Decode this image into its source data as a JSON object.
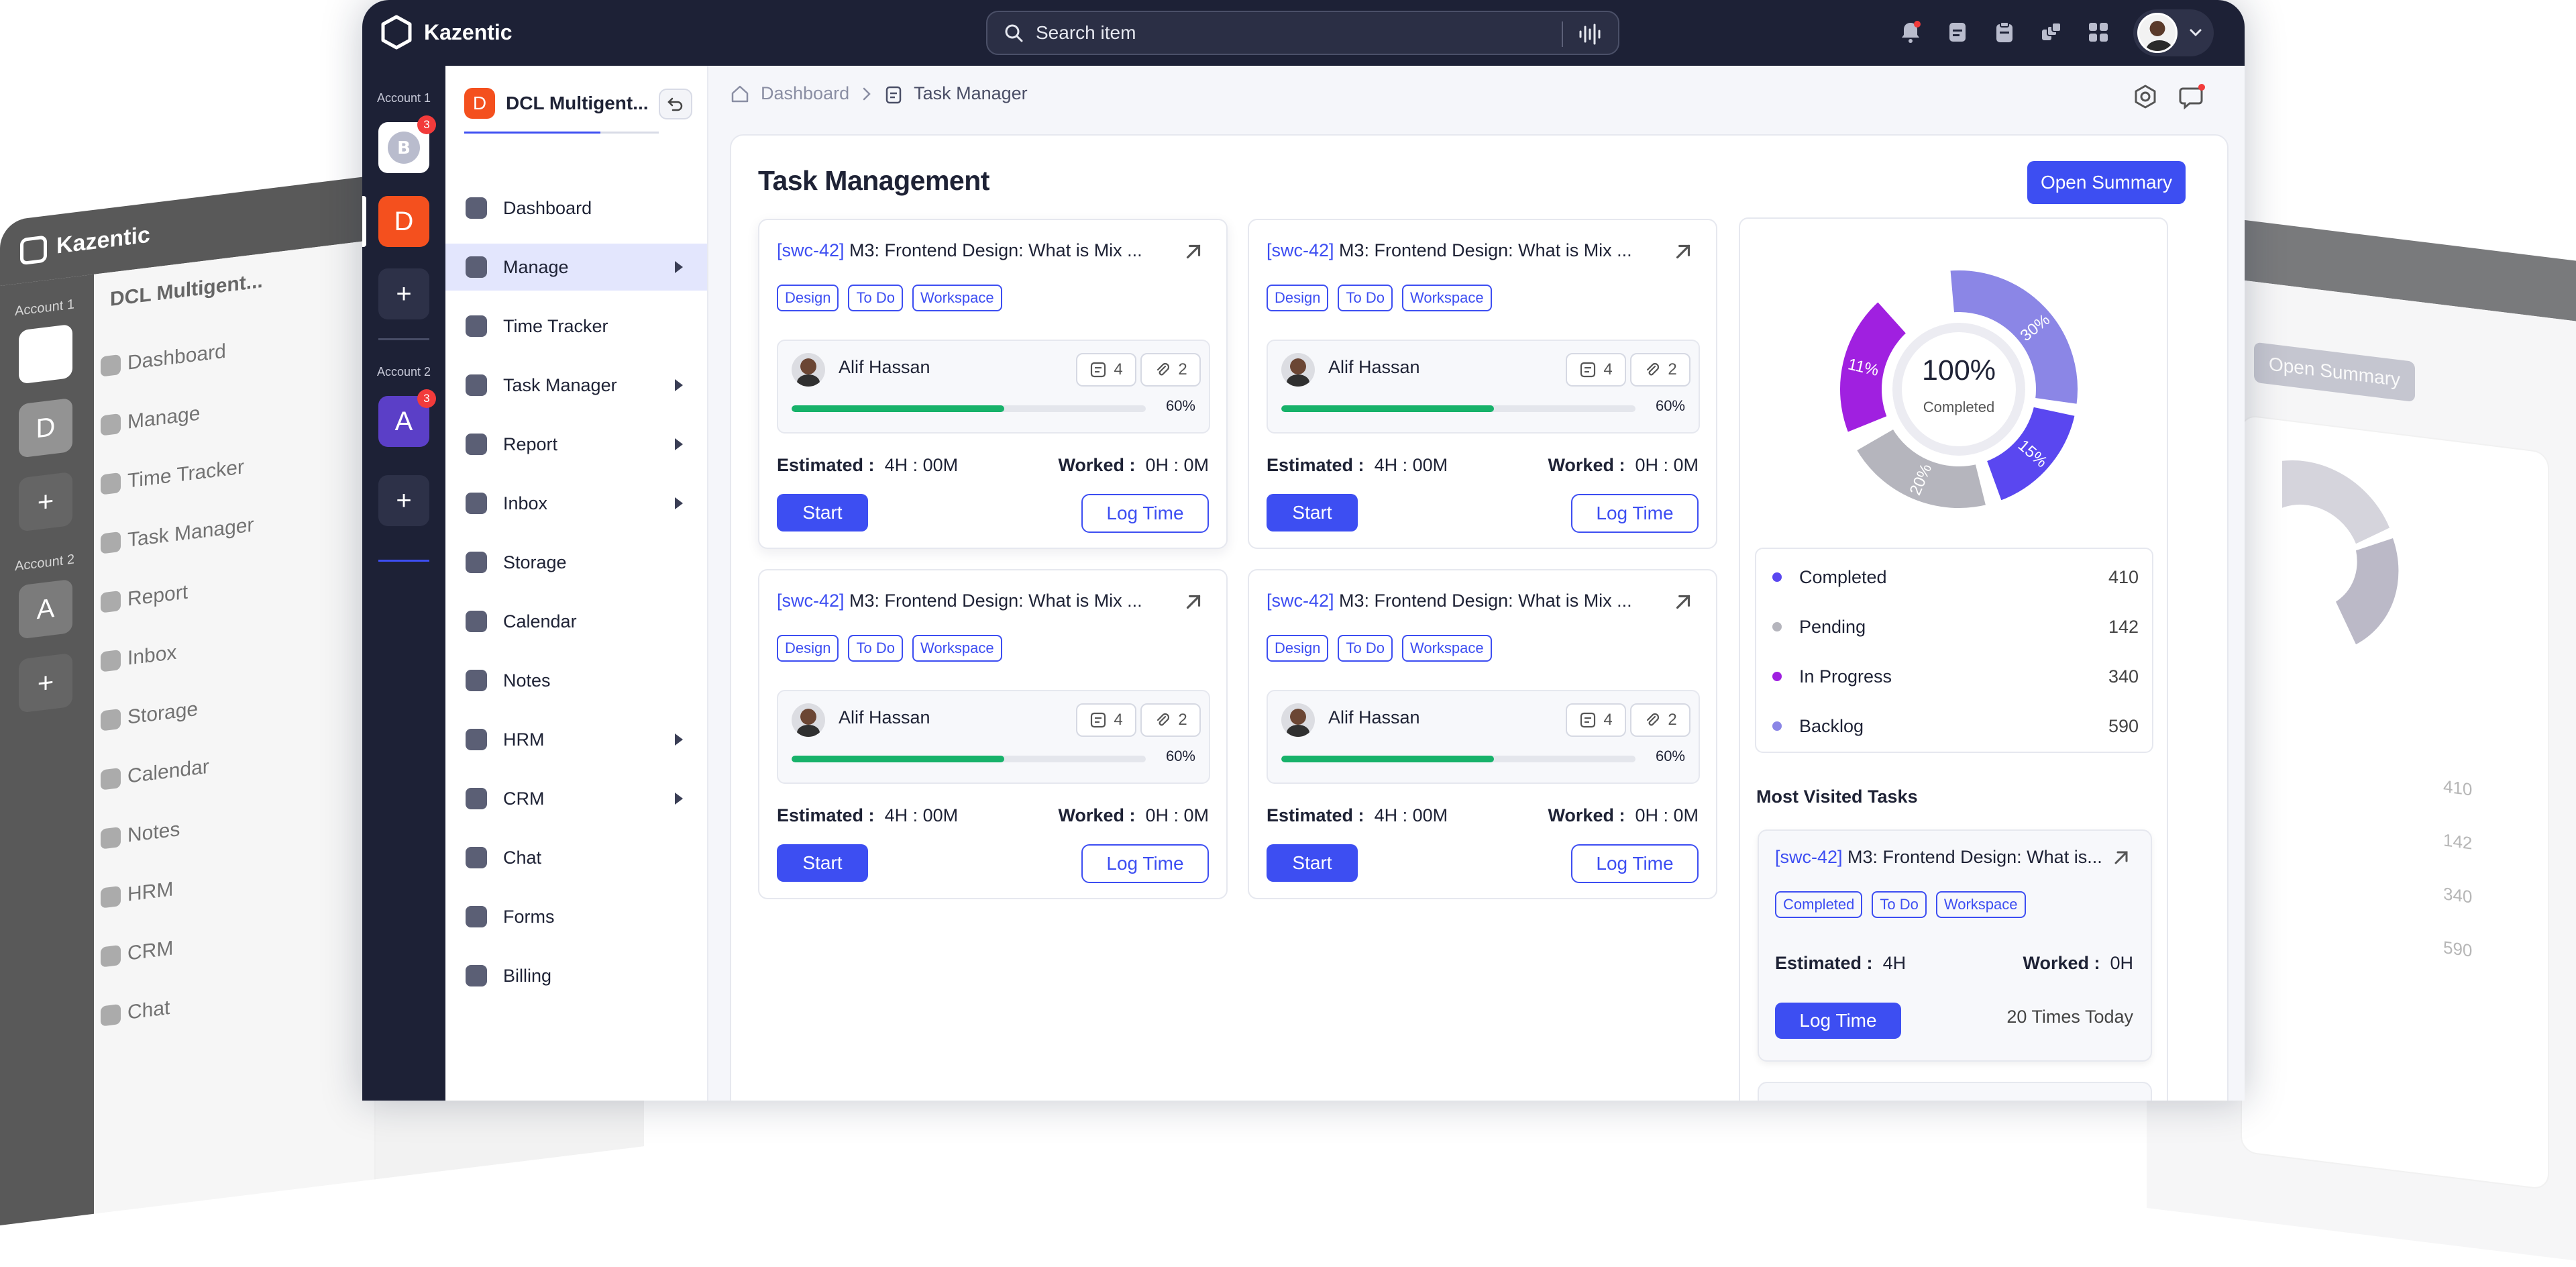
{
  "app": {
    "name": "Kazentic"
  },
  "search": {
    "placeholder": "Search item"
  },
  "rail": {
    "account1_label": "Account 1",
    "account1_badge": "3",
    "org_letter": "D",
    "plus": "+",
    "account2_label": "Account 2",
    "account2_letter": "A",
    "account2_badge": "3"
  },
  "nav": {
    "org_name": "DCL Multigent...",
    "items": [
      {
        "label": "Dashboard",
        "icon": "home-icon"
      },
      {
        "label": "Manage",
        "icon": "layers-icon"
      },
      {
        "label": "Time Tracker",
        "icon": "clock-icon"
      },
      {
        "label": "Task Manager",
        "icon": "clipboard-icon"
      },
      {
        "label": "Report",
        "icon": "chart-icon"
      },
      {
        "label": "Inbox",
        "icon": "inbox-icon"
      },
      {
        "label": "Storage",
        "icon": "cloud-icon"
      },
      {
        "label": "Calendar",
        "icon": "calendar-icon"
      },
      {
        "label": "Notes",
        "icon": "note-icon"
      },
      {
        "label": "HRM",
        "icon": "badge-icon"
      },
      {
        "label": "CRM",
        "icon": "crm-icon"
      },
      {
        "label": "Chat",
        "icon": "chat-icon"
      },
      {
        "label": "Forms",
        "icon": "form-icon"
      },
      {
        "label": "Billing",
        "icon": "billing-icon"
      }
    ]
  },
  "breadcrumb": {
    "home": "Dashboard",
    "current": "Task Manager"
  },
  "page": {
    "title": "Task Management",
    "summary_button": "Open Summary"
  },
  "task": {
    "key": "[swc-42]",
    "title": "M3: Frontend Design: What is Mix ...",
    "tags": [
      "Design",
      "To Do",
      "Workspace"
    ],
    "assignee": "Alif Hassan",
    "notes_count": "4",
    "attach_count": "2",
    "progress": 0.6,
    "progress_label": "60%",
    "estimated_label": "Estimated :",
    "estimated_value": "4H : 00M",
    "worked_label": "Worked :",
    "worked_value": "0H : 0M",
    "start_button": "Start",
    "log_button": "Log Time"
  },
  "summary": {
    "center_value": "100%",
    "center_label": "Completed",
    "segments": [
      {
        "label": "30%",
        "color": "#8b86e6"
      },
      {
        "label": "15%",
        "color": "#5a47f0"
      },
      {
        "label": "20%",
        "color": "#b5b5bd"
      },
      {
        "label": "11%",
        "color": "#a020e0"
      }
    ],
    "legend": [
      {
        "label": "Completed",
        "value": "410",
        "color": "#5a47f0"
      },
      {
        "label": "Pending",
        "value": "142",
        "color": "#b5b5bd"
      },
      {
        "label": "In Progress",
        "value": "340",
        "color": "#a020e0"
      },
      {
        "label": "Backlog",
        "value": "590",
        "color": "#8b86e6"
      }
    ]
  },
  "most_visited": {
    "heading": "Most Visited Tasks",
    "key": "[swc-42]",
    "title": "M3: Frontend Design: What is...",
    "tags": [
      "Completed",
      "To Do",
      "Workspace"
    ],
    "estimated_label": "Estimated :",
    "estimated_value": "4H",
    "worked_label": "Worked :",
    "worked_value": "0H",
    "log_button": "Log Time",
    "visits": "20 Times Today"
  },
  "back_left": {
    "items": [
      "Dashboard",
      "Manage",
      "Time Tracker",
      "Task Manager",
      "Report",
      "Inbox",
      "Storage",
      "Calendar",
      "Notes",
      "HRM",
      "CRM",
      "Chat"
    ]
  },
  "back_right": {
    "values": [
      "410",
      "142",
      "340",
      "590"
    ]
  }
}
